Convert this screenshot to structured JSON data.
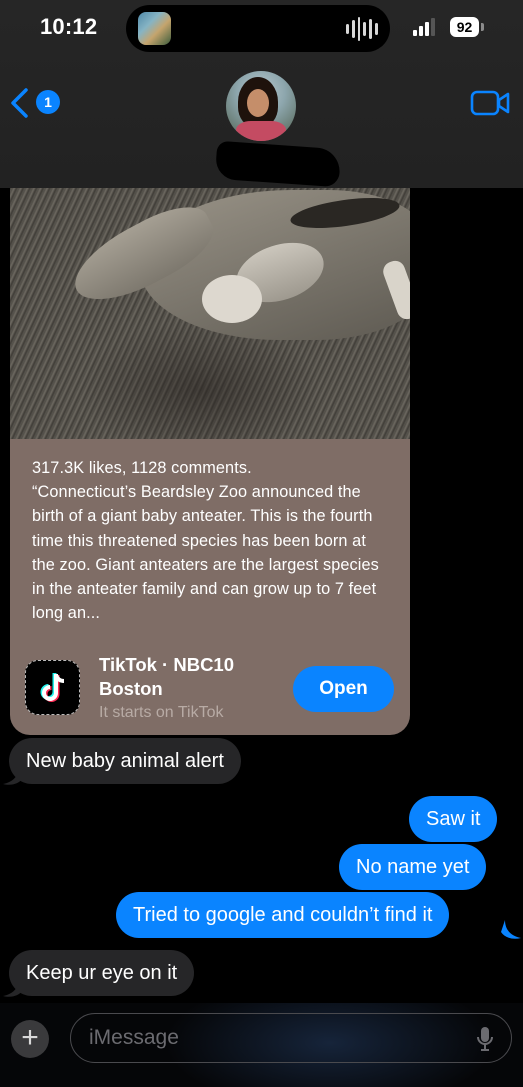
{
  "status_bar": {
    "time": "10:12",
    "battery": "92"
  },
  "header": {
    "back_badge_count": "1",
    "icons": [
      "chevron-left-icon",
      "video-camera-icon"
    ],
    "accent_color": "#0a84ff"
  },
  "link_preview": {
    "description": "317.3K likes, 1128 comments.\n“Connecticut’s Beardsley Zoo announced the birth of a giant baby anteater. This is the fourth time this threatened species has been born at the zoo.  Giant anteaters are the largest species in the anteater family and can grow up to 7 feet long an...",
    "source_line1": "TikTok · NBC10",
    "source_line2": "Boston",
    "subtitle": "It starts on TikTok",
    "open_label": "Open",
    "card_color": "#7f6d66"
  },
  "messages": [
    {
      "direction": "incoming",
      "text": "New baby animal alert"
    },
    {
      "direction": "outgoing",
      "text": "Saw it"
    },
    {
      "direction": "outgoing",
      "text": "No name yet"
    },
    {
      "direction": "outgoing",
      "text": "Tried to google and couldn’t find it"
    },
    {
      "direction": "incoming",
      "text": "Keep ur eye on it"
    }
  ],
  "input_bar": {
    "placeholder": "iMessage",
    "plus_label": "+"
  }
}
